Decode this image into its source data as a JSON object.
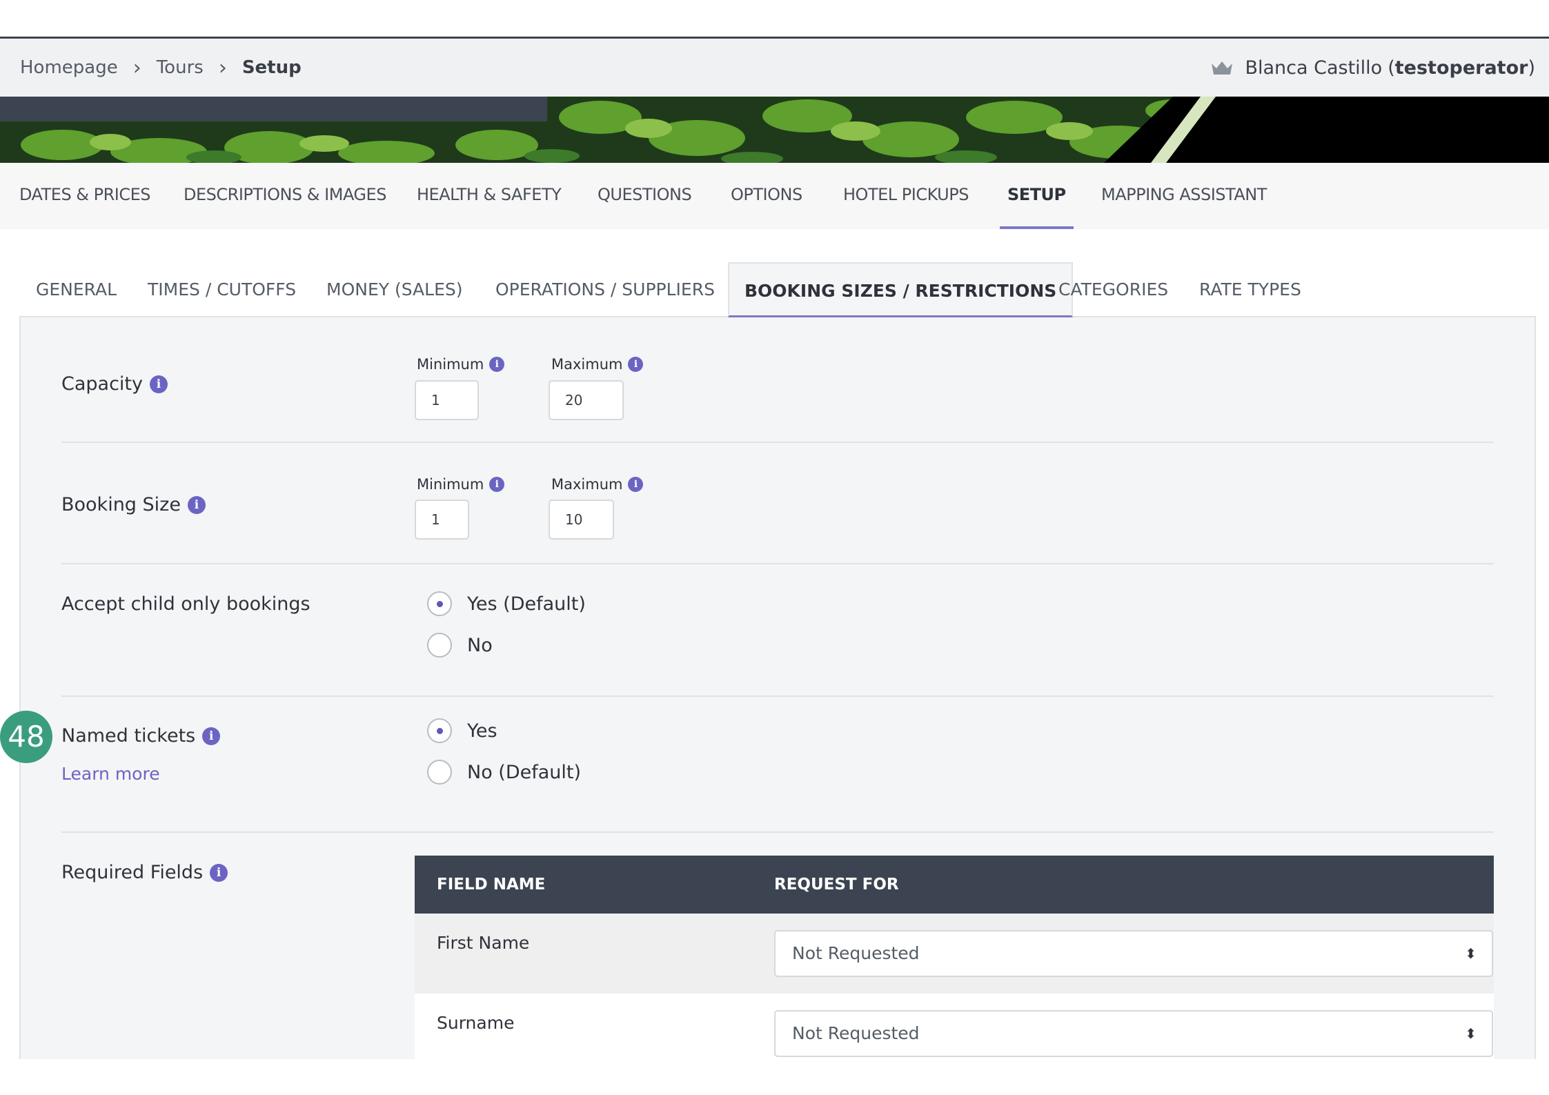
{
  "breadcrumb": {
    "items": [
      "Homepage",
      "Tours",
      "Setup"
    ]
  },
  "user": {
    "name": "Blanca Castillo",
    "username": "testoperator",
    "open_paren": "(",
    "close_paren": ")"
  },
  "main_tabs": [
    "DATES & PRICES",
    "DESCRIPTIONS & IMAGES",
    "HEALTH & SAFETY",
    "QUESTIONS",
    "OPTIONS",
    "HOTEL PICKUPS",
    "SETUP",
    "MAPPING ASSISTANT"
  ],
  "main_tab_active": "SETUP",
  "sub_tabs": [
    "GENERAL",
    "TIMES / CUTOFFS",
    "MONEY (SALES)",
    "OPERATIONS / SUPPLIERS",
    "BOOKING SIZES / RESTRICTIONS",
    "CATEGORIES",
    "RATE TYPES"
  ],
  "sub_tab_active": "BOOKING SIZES / RESTRICTIONS",
  "capacity": {
    "label": "Capacity",
    "min_label": "Minimum",
    "max_label": "Maximum",
    "min_value": "1",
    "max_value": "20"
  },
  "booking_size": {
    "label": "Booking Size",
    "min_label": "Minimum",
    "max_label": "Maximum",
    "min_value": "1",
    "max_value": "10"
  },
  "child_only": {
    "label": "Accept child only bookings",
    "options": [
      "Yes (Default)",
      "No"
    ],
    "selected": "Yes (Default)"
  },
  "named_tickets": {
    "label": "Named tickets",
    "learn_more": "Learn more",
    "options": [
      "Yes",
      "No (Default)"
    ],
    "selected": "Yes"
  },
  "required_fields": {
    "label": "Required Fields",
    "columns": [
      "FIELD NAME",
      "REQUEST FOR"
    ],
    "rows": [
      {
        "field": "First Name",
        "request_for": "Not Requested"
      },
      {
        "field": "Surname",
        "request_for": "Not Requested"
      }
    ]
  },
  "step_badge": "48",
  "info_glyph": "i",
  "select_arrows_glyph": "⬍",
  "colors": {
    "accent": "#6b64c2",
    "header_dark": "#3b4450",
    "badge": "#3a9d7e",
    "panel_bg": "#f4f5f7"
  }
}
